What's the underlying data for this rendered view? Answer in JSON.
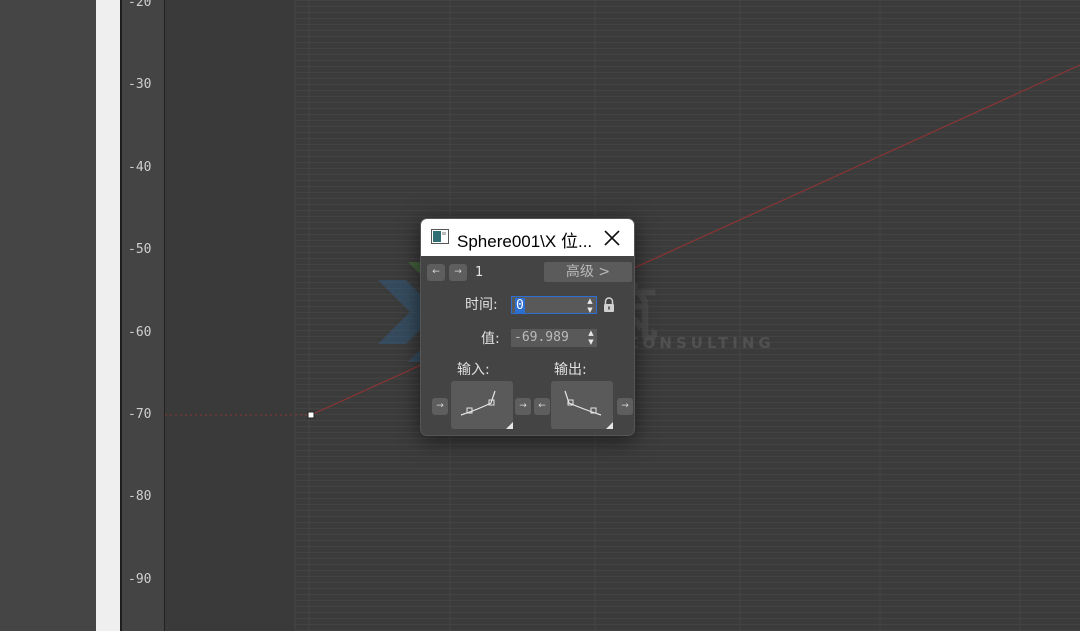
{
  "ruler": {
    "ticks": [
      "-20",
      "-30",
      "-40",
      "-50",
      "-60",
      "-70",
      "-80",
      "-90"
    ]
  },
  "curve": {
    "color": "#8a3434",
    "key": {
      "time": 0,
      "value": -69.989
    }
  },
  "dialog": {
    "title": "Sphere001\\X 位...",
    "key_number": "1",
    "advanced_label": "高级 >",
    "time_label": "时间:",
    "time_value": "0",
    "value_label": "值:",
    "value_value": "-69.989",
    "in_label": "输入:",
    "out_label": "输出:"
  },
  "watermark": {
    "chars": "广筑",
    "sub": "ING CONSULTING"
  },
  "icons": [
    "app-icon",
    "close-icon",
    "prev-key-icon",
    "next-key-icon",
    "lock-icon",
    "spinner-arrows-icon",
    "tangent-in-icon",
    "tangent-out-icon"
  ]
}
